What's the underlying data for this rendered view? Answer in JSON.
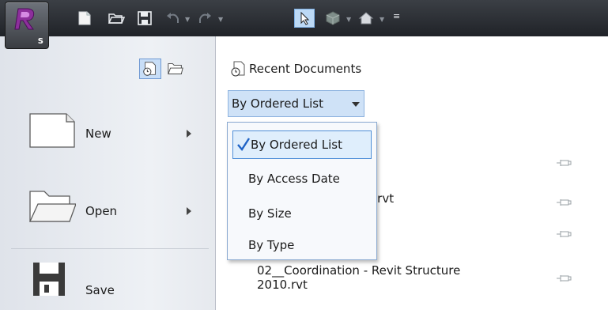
{
  "app": {
    "button_letter": "S",
    "accent": "#7b2d8e"
  },
  "toolbar": {
    "icons": [
      "new-doc-icon",
      "open-folder-icon",
      "save-disk-icon",
      "undo-icon",
      "redo-icon",
      "select-arrow-icon",
      "3d-view-icon",
      "house-icon",
      "customize-caret-icon"
    ]
  },
  "left_menu": {
    "items": [
      {
        "label": "New",
        "icon": "new-document-icon",
        "has_submenu": true
      },
      {
        "label": "Open",
        "icon": "open-folder-icon",
        "has_submenu": true
      },
      {
        "label": "Save",
        "icon": "save-disk-icon",
        "has_submenu": false
      }
    ]
  },
  "recent": {
    "title": "Recent Documents",
    "sort_selected": "By Ordered List",
    "sort_options": [
      "By Ordered List",
      "By Access Date",
      "By Size",
      "By Type"
    ],
    "files": [
      {
        "name": "T.rvt"
      },
      {
        "name": "02__Coordination - Revit Structure\n2010.rvt"
      }
    ]
  }
}
